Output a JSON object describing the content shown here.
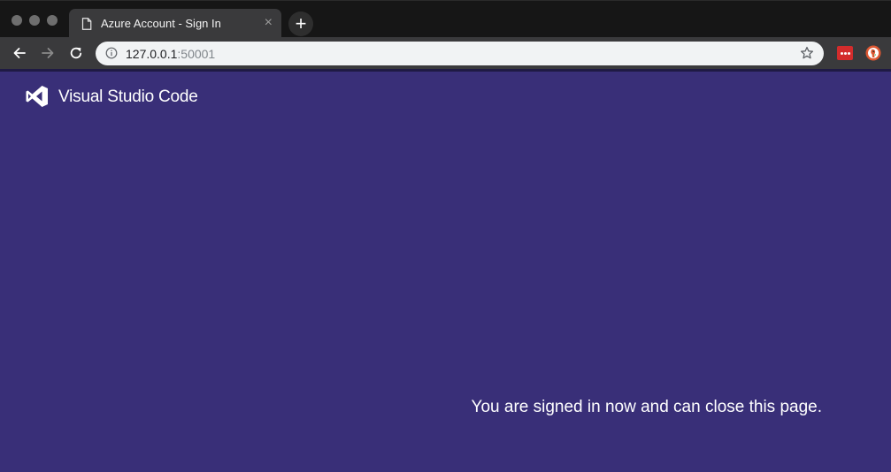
{
  "browser": {
    "tab": {
      "title": "Azure Account - Sign In",
      "close_glyph": "×",
      "icon": "page-icon"
    },
    "new_tab_glyph": "+",
    "address_bar": {
      "host": "127.0.0.1",
      "port": ":50001",
      "info_icon": "info-icon",
      "bookmark_icon": "star-icon"
    },
    "nav": [
      "back-icon",
      "forward-icon",
      "reload-icon"
    ],
    "extensions": [
      "lastpass-icon",
      "duckduckgo-icon"
    ]
  },
  "page": {
    "brand_name": "Visual Studio Code",
    "message": "You are signed in now and can close this page.",
    "background": "#392f78"
  }
}
